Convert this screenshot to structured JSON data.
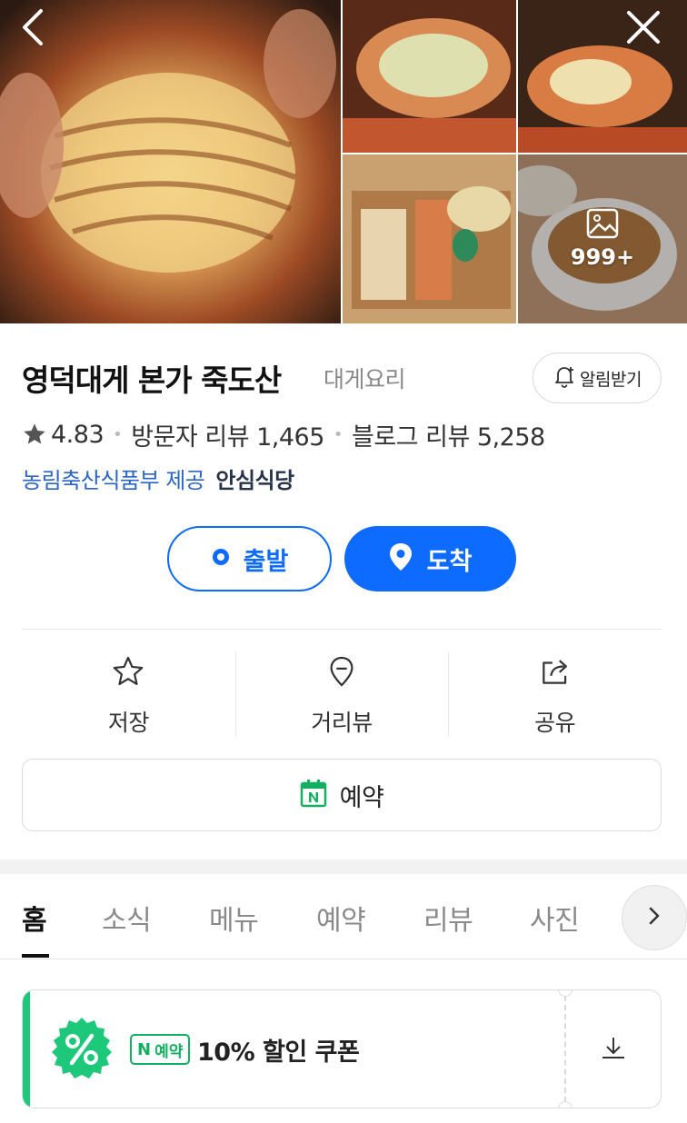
{
  "header": {
    "more_photos_count": "999+"
  },
  "place": {
    "name": "영덕대게 본가 죽도산",
    "category": "대게요리",
    "alarm_label": "알림받기",
    "rating": "4.83",
    "visitor_reviews": "방문자 리뷰 1,465",
    "blog_reviews": "블로그 리뷰 5,258",
    "provider": "농림축산식품부 제공",
    "safe_badge": "안심식당"
  },
  "route": {
    "start_label": "출발",
    "end_label": "도착"
  },
  "actions": {
    "save_label": "저장",
    "streetview_label": "거리뷰",
    "share_label": "공유"
  },
  "reserve": {
    "label": "예약"
  },
  "tabs": {
    "items": [
      "홈",
      "소식",
      "메뉴",
      "예약",
      "리뷰",
      "사진"
    ]
  },
  "coupon": {
    "badge_letter": "N",
    "badge_text": "예약",
    "title": "10% 할인 쿠폰"
  },
  "colors": {
    "primary_blue": "#0d6bff",
    "link_blue": "#2a64c8",
    "naver_green": "#12b060"
  }
}
